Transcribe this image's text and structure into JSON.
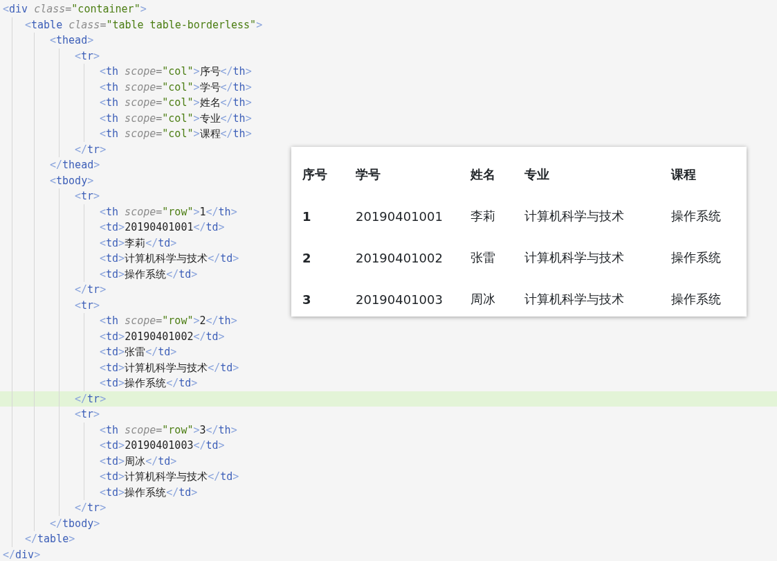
{
  "editor": {
    "tree": [
      {
        "open": {
          "highlighted": false,
          "tokens": [
            {
              "kind": "punct",
              "text": "<"
            },
            {
              "kind": "tag",
              "text": "div"
            },
            {
              "kind": "attr",
              "text": " class"
            },
            {
              "kind": "equals",
              "text": "="
            },
            {
              "kind": "string",
              "text": "\"container\""
            },
            {
              "kind": "punct",
              "text": ">"
            }
          ]
        },
        "children": [
          {
            "open": {
              "highlighted": false,
              "tokens": [
                {
                  "kind": "punct",
                  "text": "<"
                },
                {
                  "kind": "tag",
                  "text": "table"
                },
                {
                  "kind": "attr",
                  "text": " class"
                },
                {
                  "kind": "equals",
                  "text": "="
                },
                {
                  "kind": "string",
                  "text": "\"table table-borderless\""
                },
                {
                  "kind": "punct",
                  "text": ">"
                }
              ]
            },
            "children": [
              {
                "open": {
                  "highlighted": false,
                  "tokens": [
                    {
                      "kind": "punct",
                      "text": "<"
                    },
                    {
                      "kind": "tag",
                      "text": "thead"
                    },
                    {
                      "kind": "punct",
                      "text": ">"
                    }
                  ]
                },
                "children": [
                  {
                    "open": {
                      "highlighted": false,
                      "tokens": [
                        {
                          "kind": "punct",
                          "text": "<"
                        },
                        {
                          "kind": "tag",
                          "text": "tr"
                        },
                        {
                          "kind": "punct",
                          "text": ">"
                        }
                      ]
                    },
                    "children": [
                      {
                        "line": {
                          "highlighted": false,
                          "tokens": [
                            {
                              "kind": "punct",
                              "text": "<"
                            },
                            {
                              "kind": "tag",
                              "text": "th"
                            },
                            {
                              "kind": "attr",
                              "text": " scope"
                            },
                            {
                              "kind": "equals",
                              "text": "="
                            },
                            {
                              "kind": "string",
                              "text": "\"col\""
                            },
                            {
                              "kind": "punct",
                              "text": ">"
                            },
                            {
                              "kind": "text",
                              "text": "序号"
                            },
                            {
                              "kind": "punct",
                              "text": "</"
                            },
                            {
                              "kind": "tag",
                              "text": "th"
                            },
                            {
                              "kind": "punct",
                              "text": ">"
                            }
                          ]
                        }
                      },
                      {
                        "line": {
                          "highlighted": false,
                          "tokens": [
                            {
                              "kind": "punct",
                              "text": "<"
                            },
                            {
                              "kind": "tag",
                              "text": "th"
                            },
                            {
                              "kind": "attr",
                              "text": " scope"
                            },
                            {
                              "kind": "equals",
                              "text": "="
                            },
                            {
                              "kind": "string",
                              "text": "\"col\""
                            },
                            {
                              "kind": "punct",
                              "text": ">"
                            },
                            {
                              "kind": "text",
                              "text": "学号"
                            },
                            {
                              "kind": "punct",
                              "text": "</"
                            },
                            {
                              "kind": "tag",
                              "text": "th"
                            },
                            {
                              "kind": "punct",
                              "text": ">"
                            }
                          ]
                        }
                      },
                      {
                        "line": {
                          "highlighted": false,
                          "tokens": [
                            {
                              "kind": "punct",
                              "text": "<"
                            },
                            {
                              "kind": "tag",
                              "text": "th"
                            },
                            {
                              "kind": "attr",
                              "text": " scope"
                            },
                            {
                              "kind": "equals",
                              "text": "="
                            },
                            {
                              "kind": "string",
                              "text": "\"col\""
                            },
                            {
                              "kind": "punct",
                              "text": ">"
                            },
                            {
                              "kind": "text",
                              "text": "姓名"
                            },
                            {
                              "kind": "punct",
                              "text": "</"
                            },
                            {
                              "kind": "tag",
                              "text": "th"
                            },
                            {
                              "kind": "punct",
                              "text": ">"
                            }
                          ]
                        }
                      },
                      {
                        "line": {
                          "highlighted": false,
                          "tokens": [
                            {
                              "kind": "punct",
                              "text": "<"
                            },
                            {
                              "kind": "tag",
                              "text": "th"
                            },
                            {
                              "kind": "attr",
                              "text": " scope"
                            },
                            {
                              "kind": "equals",
                              "text": "="
                            },
                            {
                              "kind": "string",
                              "text": "\"col\""
                            },
                            {
                              "kind": "punct",
                              "text": ">"
                            },
                            {
                              "kind": "text",
                              "text": "专业"
                            },
                            {
                              "kind": "punct",
                              "text": "</"
                            },
                            {
                              "kind": "tag",
                              "text": "th"
                            },
                            {
                              "kind": "punct",
                              "text": ">"
                            }
                          ]
                        }
                      },
                      {
                        "line": {
                          "highlighted": false,
                          "tokens": [
                            {
                              "kind": "punct",
                              "text": "<"
                            },
                            {
                              "kind": "tag",
                              "text": "th"
                            },
                            {
                              "kind": "attr",
                              "text": " scope"
                            },
                            {
                              "kind": "equals",
                              "text": "="
                            },
                            {
                              "kind": "string",
                              "text": "\"col\""
                            },
                            {
                              "kind": "punct",
                              "text": ">"
                            },
                            {
                              "kind": "text",
                              "text": "课程"
                            },
                            {
                              "kind": "punct",
                              "text": "</"
                            },
                            {
                              "kind": "tag",
                              "text": "th"
                            },
                            {
                              "kind": "punct",
                              "text": ">"
                            }
                          ]
                        }
                      }
                    ],
                    "close": {
                      "highlighted": false,
                      "tokens": [
                        {
                          "kind": "punct",
                          "text": "</"
                        },
                        {
                          "kind": "tag",
                          "text": "tr"
                        },
                        {
                          "kind": "punct",
                          "text": ">"
                        }
                      ]
                    }
                  }
                ],
                "close": {
                  "highlighted": false,
                  "tokens": [
                    {
                      "kind": "punct",
                      "text": "</"
                    },
                    {
                      "kind": "tag",
                      "text": "thead"
                    },
                    {
                      "kind": "punct",
                      "text": ">"
                    }
                  ]
                }
              },
              {
                "open": {
                  "highlighted": false,
                  "tokens": [
                    {
                      "kind": "punct",
                      "text": "<"
                    },
                    {
                      "kind": "tag",
                      "text": "tbody"
                    },
                    {
                      "kind": "punct",
                      "text": ">"
                    }
                  ]
                },
                "children": [
                  {
                    "open": {
                      "highlighted": false,
                      "tokens": [
                        {
                          "kind": "punct",
                          "text": "<"
                        },
                        {
                          "kind": "tag",
                          "text": "tr"
                        },
                        {
                          "kind": "punct",
                          "text": ">"
                        }
                      ]
                    },
                    "children": [
                      {
                        "line": {
                          "highlighted": false,
                          "tokens": [
                            {
                              "kind": "punct",
                              "text": "<"
                            },
                            {
                              "kind": "tag",
                              "text": "th"
                            },
                            {
                              "kind": "attr",
                              "text": " scope"
                            },
                            {
                              "kind": "equals",
                              "text": "="
                            },
                            {
                              "kind": "string",
                              "text": "\"row\""
                            },
                            {
                              "kind": "punct",
                              "text": ">"
                            },
                            {
                              "kind": "text",
                              "text": "1"
                            },
                            {
                              "kind": "punct",
                              "text": "</"
                            },
                            {
                              "kind": "tag",
                              "text": "th"
                            },
                            {
                              "kind": "punct",
                              "text": ">"
                            }
                          ]
                        }
                      },
                      {
                        "line": {
                          "highlighted": false,
                          "tokens": [
                            {
                              "kind": "punct",
                              "text": "<"
                            },
                            {
                              "kind": "tag",
                              "text": "td"
                            },
                            {
                              "kind": "punct",
                              "text": ">"
                            },
                            {
                              "kind": "text",
                              "text": "20190401001"
                            },
                            {
                              "kind": "punct",
                              "text": "</"
                            },
                            {
                              "kind": "tag",
                              "text": "td"
                            },
                            {
                              "kind": "punct",
                              "text": ">"
                            }
                          ]
                        }
                      },
                      {
                        "line": {
                          "highlighted": false,
                          "tokens": [
                            {
                              "kind": "punct",
                              "text": "<"
                            },
                            {
                              "kind": "tag",
                              "text": "td"
                            },
                            {
                              "kind": "punct",
                              "text": ">"
                            },
                            {
                              "kind": "text",
                              "text": "李莉"
                            },
                            {
                              "kind": "punct",
                              "text": "</"
                            },
                            {
                              "kind": "tag",
                              "text": "td"
                            },
                            {
                              "kind": "punct",
                              "text": ">"
                            }
                          ]
                        }
                      },
                      {
                        "line": {
                          "highlighted": false,
                          "tokens": [
                            {
                              "kind": "punct",
                              "text": "<"
                            },
                            {
                              "kind": "tag",
                              "text": "td"
                            },
                            {
                              "kind": "punct",
                              "text": ">"
                            },
                            {
                              "kind": "text",
                              "text": "计算机科学与技术"
                            },
                            {
                              "kind": "punct",
                              "text": "</"
                            },
                            {
                              "kind": "tag",
                              "text": "td"
                            },
                            {
                              "kind": "punct",
                              "text": ">"
                            }
                          ]
                        }
                      },
                      {
                        "line": {
                          "highlighted": false,
                          "tokens": [
                            {
                              "kind": "punct",
                              "text": "<"
                            },
                            {
                              "kind": "tag",
                              "text": "td"
                            },
                            {
                              "kind": "punct",
                              "text": ">"
                            },
                            {
                              "kind": "text",
                              "text": "操作系统"
                            },
                            {
                              "kind": "punct",
                              "text": "</"
                            },
                            {
                              "kind": "tag",
                              "text": "td"
                            },
                            {
                              "kind": "punct",
                              "text": ">"
                            }
                          ]
                        }
                      }
                    ],
                    "close": {
                      "highlighted": false,
                      "tokens": [
                        {
                          "kind": "punct",
                          "text": "</"
                        },
                        {
                          "kind": "tag",
                          "text": "tr"
                        },
                        {
                          "kind": "punct",
                          "text": ">"
                        }
                      ]
                    }
                  },
                  {
                    "open": {
                      "highlighted": false,
                      "tokens": [
                        {
                          "kind": "punct",
                          "text": "<"
                        },
                        {
                          "kind": "tag",
                          "text": "tr"
                        },
                        {
                          "kind": "punct",
                          "text": ">"
                        }
                      ]
                    },
                    "children": [
                      {
                        "line": {
                          "highlighted": false,
                          "tokens": [
                            {
                              "kind": "punct",
                              "text": "<"
                            },
                            {
                              "kind": "tag",
                              "text": "th"
                            },
                            {
                              "kind": "attr",
                              "text": " scope"
                            },
                            {
                              "kind": "equals",
                              "text": "="
                            },
                            {
                              "kind": "string",
                              "text": "\"row\""
                            },
                            {
                              "kind": "punct",
                              "text": ">"
                            },
                            {
                              "kind": "text",
                              "text": "2"
                            },
                            {
                              "kind": "punct",
                              "text": "</"
                            },
                            {
                              "kind": "tag",
                              "text": "th"
                            },
                            {
                              "kind": "punct",
                              "text": ">"
                            }
                          ]
                        }
                      },
                      {
                        "line": {
                          "highlighted": false,
                          "tokens": [
                            {
                              "kind": "punct",
                              "text": "<"
                            },
                            {
                              "kind": "tag",
                              "text": "td"
                            },
                            {
                              "kind": "punct",
                              "text": ">"
                            },
                            {
                              "kind": "text",
                              "text": "20190401002"
                            },
                            {
                              "kind": "punct",
                              "text": "</"
                            },
                            {
                              "kind": "tag",
                              "text": "td"
                            },
                            {
                              "kind": "punct",
                              "text": ">"
                            }
                          ]
                        }
                      },
                      {
                        "line": {
                          "highlighted": false,
                          "tokens": [
                            {
                              "kind": "punct",
                              "text": "<"
                            },
                            {
                              "kind": "tag",
                              "text": "td"
                            },
                            {
                              "kind": "punct",
                              "text": ">"
                            },
                            {
                              "kind": "text",
                              "text": "张雷"
                            },
                            {
                              "kind": "punct",
                              "text": "</"
                            },
                            {
                              "kind": "tag",
                              "text": "td"
                            },
                            {
                              "kind": "punct",
                              "text": ">"
                            }
                          ]
                        }
                      },
                      {
                        "line": {
                          "highlighted": false,
                          "tokens": [
                            {
                              "kind": "punct",
                              "text": "<"
                            },
                            {
                              "kind": "tag",
                              "text": "td"
                            },
                            {
                              "kind": "punct",
                              "text": ">"
                            },
                            {
                              "kind": "text",
                              "text": "计算机科学与技术"
                            },
                            {
                              "kind": "punct",
                              "text": "</"
                            },
                            {
                              "kind": "tag",
                              "text": "td"
                            },
                            {
                              "kind": "punct",
                              "text": ">"
                            }
                          ]
                        }
                      },
                      {
                        "line": {
                          "highlighted": false,
                          "tokens": [
                            {
                              "kind": "punct",
                              "text": "<"
                            },
                            {
                              "kind": "tag",
                              "text": "td"
                            },
                            {
                              "kind": "punct",
                              "text": ">"
                            },
                            {
                              "kind": "text",
                              "text": "操作系统"
                            },
                            {
                              "kind": "punct",
                              "text": "</"
                            },
                            {
                              "kind": "tag",
                              "text": "td"
                            },
                            {
                              "kind": "punct",
                              "text": ">"
                            }
                          ]
                        }
                      }
                    ],
                    "close": {
                      "highlighted": true,
                      "tokens": [
                        {
                          "kind": "punct",
                          "text": "</"
                        },
                        {
                          "kind": "tag",
                          "text": "tr"
                        },
                        {
                          "kind": "punct",
                          "text": ">"
                        }
                      ]
                    }
                  },
                  {
                    "open": {
                      "highlighted": false,
                      "tokens": [
                        {
                          "kind": "punct",
                          "text": "<"
                        },
                        {
                          "kind": "tag",
                          "text": "tr"
                        },
                        {
                          "kind": "punct",
                          "text": ">"
                        }
                      ]
                    },
                    "children": [
                      {
                        "line": {
                          "highlighted": false,
                          "tokens": [
                            {
                              "kind": "punct",
                              "text": "<"
                            },
                            {
                              "kind": "tag",
                              "text": "th"
                            },
                            {
                              "kind": "attr",
                              "text": " scope"
                            },
                            {
                              "kind": "equals",
                              "text": "="
                            },
                            {
                              "kind": "string",
                              "text": "\"row\""
                            },
                            {
                              "kind": "punct",
                              "text": ">"
                            },
                            {
                              "kind": "text",
                              "text": "3"
                            },
                            {
                              "kind": "punct",
                              "text": "</"
                            },
                            {
                              "kind": "tag",
                              "text": "th"
                            },
                            {
                              "kind": "punct",
                              "text": ">"
                            }
                          ]
                        }
                      },
                      {
                        "line": {
                          "highlighted": false,
                          "tokens": [
                            {
                              "kind": "punct",
                              "text": "<"
                            },
                            {
                              "kind": "tag",
                              "text": "td"
                            },
                            {
                              "kind": "punct",
                              "text": ">"
                            },
                            {
                              "kind": "text",
                              "text": "20190401003"
                            },
                            {
                              "kind": "punct",
                              "text": "</"
                            },
                            {
                              "kind": "tag",
                              "text": "td"
                            },
                            {
                              "kind": "punct",
                              "text": ">"
                            }
                          ]
                        }
                      },
                      {
                        "line": {
                          "highlighted": false,
                          "tokens": [
                            {
                              "kind": "punct",
                              "text": "<"
                            },
                            {
                              "kind": "tag",
                              "text": "td"
                            },
                            {
                              "kind": "punct",
                              "text": ">"
                            },
                            {
                              "kind": "text",
                              "text": "周冰"
                            },
                            {
                              "kind": "punct",
                              "text": "</"
                            },
                            {
                              "kind": "tag",
                              "text": "td"
                            },
                            {
                              "kind": "punct",
                              "text": ">"
                            }
                          ]
                        }
                      },
                      {
                        "line": {
                          "highlighted": false,
                          "tokens": [
                            {
                              "kind": "punct",
                              "text": "<"
                            },
                            {
                              "kind": "tag",
                              "text": "td"
                            },
                            {
                              "kind": "punct",
                              "text": ">"
                            },
                            {
                              "kind": "text",
                              "text": "计算机科学与技术"
                            },
                            {
                              "kind": "punct",
                              "text": "</"
                            },
                            {
                              "kind": "tag",
                              "text": "td"
                            },
                            {
                              "kind": "punct",
                              "text": ">"
                            }
                          ]
                        }
                      },
                      {
                        "line": {
                          "highlighted": false,
                          "tokens": [
                            {
                              "kind": "punct",
                              "text": "<"
                            },
                            {
                              "kind": "tag",
                              "text": "td"
                            },
                            {
                              "kind": "punct",
                              "text": ">"
                            },
                            {
                              "kind": "text",
                              "text": "操作系统"
                            },
                            {
                              "kind": "punct",
                              "text": "</"
                            },
                            {
                              "kind": "tag",
                              "text": "td"
                            },
                            {
                              "kind": "punct",
                              "text": ">"
                            }
                          ]
                        }
                      }
                    ],
                    "close": {
                      "highlighted": false,
                      "tokens": [
                        {
                          "kind": "punct",
                          "text": "</"
                        },
                        {
                          "kind": "tag",
                          "text": "tr"
                        },
                        {
                          "kind": "punct",
                          "text": ">"
                        }
                      ]
                    }
                  }
                ],
                "close": {
                  "highlighted": false,
                  "tokens": [
                    {
                      "kind": "punct",
                      "text": "</"
                    },
                    {
                      "kind": "tag",
                      "text": "tbody"
                    },
                    {
                      "kind": "punct",
                      "text": ">"
                    }
                  ]
                }
              }
            ],
            "close": {
              "highlighted": false,
              "tokens": [
                {
                  "kind": "punct",
                  "text": "</"
                },
                {
                  "kind": "tag",
                  "text": "table"
                },
                {
                  "kind": "punct",
                  "text": ">"
                }
              ]
            }
          }
        ],
        "close": {
          "highlighted": false,
          "tokens": [
            {
              "kind": "punct",
              "text": "</"
            },
            {
              "kind": "tag",
              "text": "div"
            },
            {
              "kind": "punct",
              "text": ">"
            }
          ]
        }
      }
    ]
  },
  "preview_table": {
    "columns": [
      "序号",
      "学号",
      "姓名",
      "专业",
      "课程"
    ],
    "rows": [
      {
        "cells": [
          "1",
          "20190401001",
          "李莉",
          "计算机科学与技术",
          "操作系统"
        ]
      },
      {
        "cells": [
          "2",
          "20190401002",
          "张雷",
          "计算机科学与技术",
          "操作系统"
        ]
      },
      {
        "cells": [
          "3",
          "20190401003",
          "周冰",
          "计算机科学与技术",
          "操作系统"
        ]
      }
    ]
  }
}
